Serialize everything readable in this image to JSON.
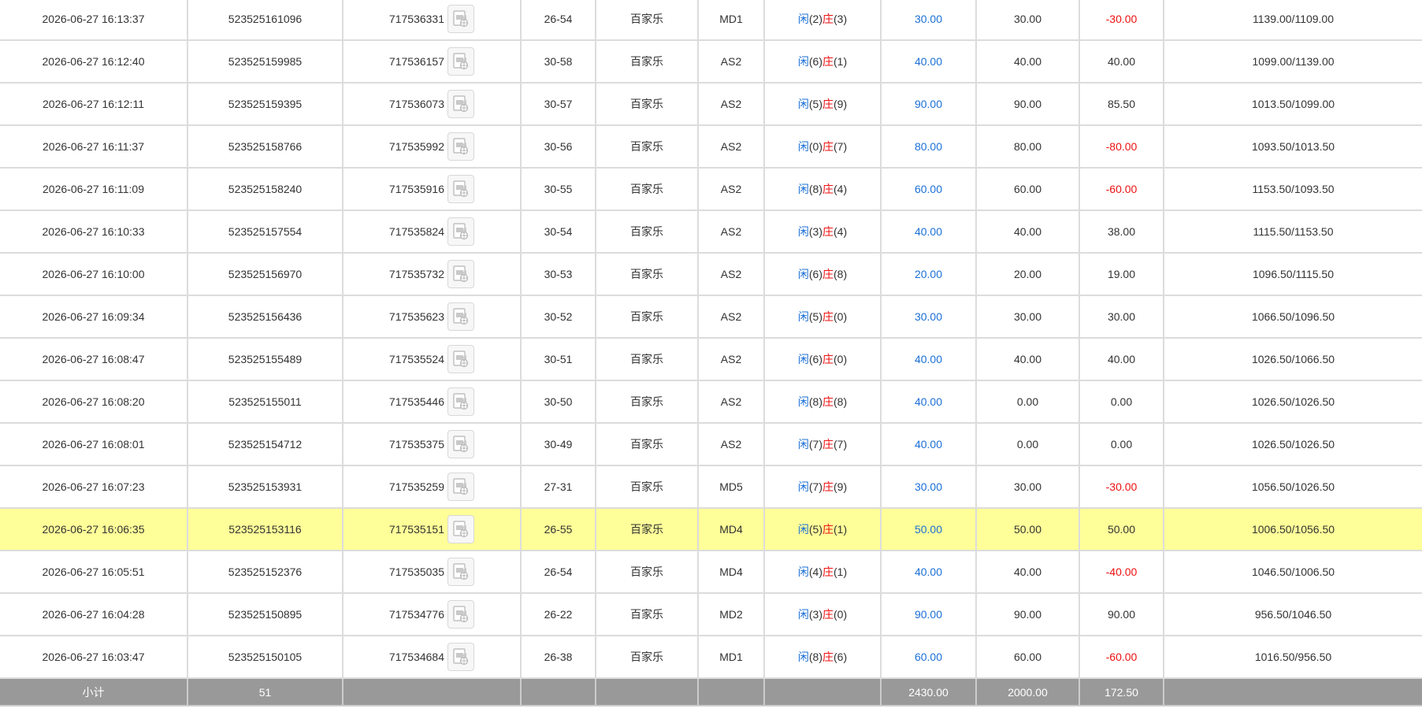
{
  "rows": [
    {
      "time": "2026-06-27 16:13:37",
      "order": "523525161096",
      "game": "717536331",
      "table": "26-54",
      "type": "百家乐",
      "room": "MD1",
      "result": {
        "p_label": "闲",
        "p": "(2)",
        "b_label": "庄",
        "b": "(3)"
      },
      "bet": "30.00",
      "valid": "30.00",
      "winloss": "-30.00",
      "neg": true,
      "balance": "1139.00/1109.00",
      "highlight": false
    },
    {
      "time": "2026-06-27 16:12:40",
      "order": "523525159985",
      "game": "717536157",
      "table": "30-58",
      "type": "百家乐",
      "room": "AS2",
      "result": {
        "p_label": "闲",
        "p": "(6)",
        "b_label": "庄",
        "b": "(1)"
      },
      "bet": "40.00",
      "valid": "40.00",
      "winloss": "40.00",
      "neg": false,
      "balance": "1099.00/1139.00",
      "highlight": false
    },
    {
      "time": "2026-06-27 16:12:11",
      "order": "523525159395",
      "game": "717536073",
      "table": "30-57",
      "type": "百家乐",
      "room": "AS2",
      "result": {
        "p_label": "闲",
        "p": "(5)",
        "b_label": "庄",
        "b": "(9)"
      },
      "bet": "90.00",
      "valid": "90.00",
      "winloss": "85.50",
      "neg": false,
      "balance": "1013.50/1099.00",
      "highlight": false
    },
    {
      "time": "2026-06-27 16:11:37",
      "order": "523525158766",
      "game": "717535992",
      "table": "30-56",
      "type": "百家乐",
      "room": "AS2",
      "result": {
        "p_label": "闲",
        "p": "(0)",
        "b_label": "庄",
        "b": "(7)"
      },
      "bet": "80.00",
      "valid": "80.00",
      "winloss": "-80.00",
      "neg": true,
      "balance": "1093.50/1013.50",
      "highlight": false
    },
    {
      "time": "2026-06-27 16:11:09",
      "order": "523525158240",
      "game": "717535916",
      "table": "30-55",
      "type": "百家乐",
      "room": "AS2",
      "result": {
        "p_label": "闲",
        "p": "(8)",
        "b_label": "庄",
        "b": "(4)"
      },
      "bet": "60.00",
      "valid": "60.00",
      "winloss": "-60.00",
      "neg": true,
      "balance": "1153.50/1093.50",
      "highlight": false
    },
    {
      "time": "2026-06-27 16:10:33",
      "order": "523525157554",
      "game": "717535824",
      "table": "30-54",
      "type": "百家乐",
      "room": "AS2",
      "result": {
        "p_label": "闲",
        "p": "(3)",
        "b_label": "庄",
        "b": "(4)"
      },
      "bet": "40.00",
      "valid": "40.00",
      "winloss": "38.00",
      "neg": false,
      "balance": "1115.50/1153.50",
      "highlight": false
    },
    {
      "time": "2026-06-27 16:10:00",
      "order": "523525156970",
      "game": "717535732",
      "table": "30-53",
      "type": "百家乐",
      "room": "AS2",
      "result": {
        "p_label": "闲",
        "p": "(6)",
        "b_label": "庄",
        "b": "(8)"
      },
      "bet": "20.00",
      "valid": "20.00",
      "winloss": "19.00",
      "neg": false,
      "balance": "1096.50/1115.50",
      "highlight": false
    },
    {
      "time": "2026-06-27 16:09:34",
      "order": "523525156436",
      "game": "717535623",
      "table": "30-52",
      "type": "百家乐",
      "room": "AS2",
      "result": {
        "p_label": "闲",
        "p": "(5)",
        "b_label": "庄",
        "b": "(0)"
      },
      "bet": "30.00",
      "valid": "30.00",
      "winloss": "30.00",
      "neg": false,
      "balance": "1066.50/1096.50",
      "highlight": false
    },
    {
      "time": "2026-06-27 16:08:47",
      "order": "523525155489",
      "game": "717535524",
      "table": "30-51",
      "type": "百家乐",
      "room": "AS2",
      "result": {
        "p_label": "闲",
        "p": "(6)",
        "b_label": "庄",
        "b": "(0)"
      },
      "bet": "40.00",
      "valid": "40.00",
      "winloss": "40.00",
      "neg": false,
      "balance": "1026.50/1066.50",
      "highlight": false
    },
    {
      "time": "2026-06-27 16:08:20",
      "order": "523525155011",
      "game": "717535446",
      "table": "30-50",
      "type": "百家乐",
      "room": "AS2",
      "result": {
        "p_label": "闲",
        "p": "(8)",
        "b_label": "庄",
        "b": "(8)"
      },
      "bet": "40.00",
      "valid": "0.00",
      "winloss": "0.00",
      "neg": false,
      "balance": "1026.50/1026.50",
      "highlight": false
    },
    {
      "time": "2026-06-27 16:08:01",
      "order": "523525154712",
      "game": "717535375",
      "table": "30-49",
      "type": "百家乐",
      "room": "AS2",
      "result": {
        "p_label": "闲",
        "p": "(7)",
        "b_label": "庄",
        "b": "(7)"
      },
      "bet": "40.00",
      "valid": "0.00",
      "winloss": "0.00",
      "neg": false,
      "balance": "1026.50/1026.50",
      "highlight": false
    },
    {
      "time": "2026-06-27 16:07:23",
      "order": "523525153931",
      "game": "717535259",
      "table": "27-31",
      "type": "百家乐",
      "room": "MD5",
      "result": {
        "p_label": "闲",
        "p": "(7)",
        "b_label": "庄",
        "b": "(9)"
      },
      "bet": "30.00",
      "valid": "30.00",
      "winloss": "-30.00",
      "neg": true,
      "balance": "1056.50/1026.50",
      "highlight": false
    },
    {
      "time": "2026-06-27 16:06:35",
      "order": "523525153116",
      "game": "717535151",
      "table": "26-55",
      "type": "百家乐",
      "room": "MD4",
      "result": {
        "p_label": "闲",
        "p": "(5)",
        "b_label": "庄",
        "b": "(1)"
      },
      "bet": "50.00",
      "valid": "50.00",
      "winloss": "50.00",
      "neg": false,
      "balance": "1006.50/1056.50",
      "highlight": true
    },
    {
      "time": "2026-06-27 16:05:51",
      "order": "523525152376",
      "game": "717535035",
      "table": "26-54",
      "type": "百家乐",
      "room": "MD4",
      "result": {
        "p_label": "闲",
        "p": "(4)",
        "b_label": "庄",
        "b": "(1)"
      },
      "bet": "40.00",
      "valid": "40.00",
      "winloss": "-40.00",
      "neg": true,
      "balance": "1046.50/1006.50",
      "highlight": false
    },
    {
      "time": "2026-06-27 16:04:28",
      "order": "523525150895",
      "game": "717534776",
      "table": "26-22",
      "type": "百家乐",
      "room": "MD2",
      "result": {
        "p_label": "闲",
        "p": "(3)",
        "b_label": "庄",
        "b": "(0)"
      },
      "bet": "90.00",
      "valid": "90.00",
      "winloss": "90.00",
      "neg": false,
      "balance": "956.50/1046.50",
      "highlight": false
    },
    {
      "time": "2026-06-27 16:03:47",
      "order": "523525150105",
      "game": "717534684",
      "table": "26-38",
      "type": "百家乐",
      "room": "MD1",
      "result": {
        "p_label": "闲",
        "p": "(8)",
        "b_label": "庄",
        "b": "(6)"
      },
      "bet": "60.00",
      "valid": "60.00",
      "winloss": "-60.00",
      "neg": true,
      "balance": "1016.50/956.50",
      "highlight": false
    }
  ],
  "subtotal": {
    "label": "小计",
    "count": "51",
    "bet": "2430.00",
    "valid": "2000.00",
    "winloss": "172.50"
  },
  "colors": {
    "blue": "#1a6fd6",
    "red": "#ee1111",
    "highlight": "#ffff99",
    "subtotal_bg": "#999999"
  },
  "icons": {
    "record": "video-record-icon"
  }
}
